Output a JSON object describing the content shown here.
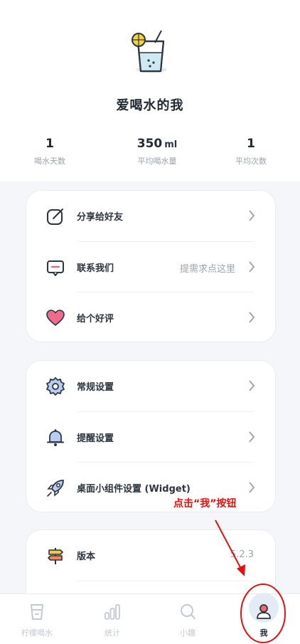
{
  "profile": {
    "nickname": "爱喝水的我",
    "avatar_icon": "drink-glass-icon"
  },
  "stats": [
    {
      "value": "1",
      "unit": "",
      "label": "喝水天数"
    },
    {
      "value": "350",
      "unit": "ml",
      "label": "平均喝水量"
    },
    {
      "value": "1",
      "unit": "",
      "label": "平均次数"
    }
  ],
  "menu_group_1": [
    {
      "label": "分享给好友",
      "hint": "",
      "icon": "share-icon"
    },
    {
      "label": "联系我们",
      "hint": "提需求点这里",
      "icon": "message-icon"
    },
    {
      "label": "给个好评",
      "hint": "",
      "icon": "heart-icon"
    }
  ],
  "menu_group_2": [
    {
      "label": "常规设置",
      "hint": "",
      "icon": "gear-icon"
    },
    {
      "label": "提醒设置",
      "hint": "",
      "icon": "bell-icon"
    },
    {
      "label": "桌面小组件设置 (Widget)",
      "hint": "",
      "icon": "rocket-icon"
    }
  ],
  "menu_group_3": [
    {
      "label": "版本",
      "hint": "5.2.3",
      "icon": "signpost-icon"
    }
  ],
  "tabbar": [
    {
      "label": "柠檬喝水",
      "icon": "cup-icon",
      "active": false
    },
    {
      "label": "统计",
      "icon": "bar-chart-icon",
      "active": false
    },
    {
      "label": "小趣",
      "icon": "search-icon",
      "active": false
    },
    {
      "label": "我",
      "icon": "user-icon",
      "active": true
    }
  ],
  "annotation": {
    "text": "点击“我”按钮",
    "color": "#e0120f"
  },
  "colors": {
    "accent": "#3d73c9",
    "text": "#2c3440",
    "muted": "#9aa3ad",
    "heart": "#f06a8a",
    "annotation": "#e0120f"
  }
}
